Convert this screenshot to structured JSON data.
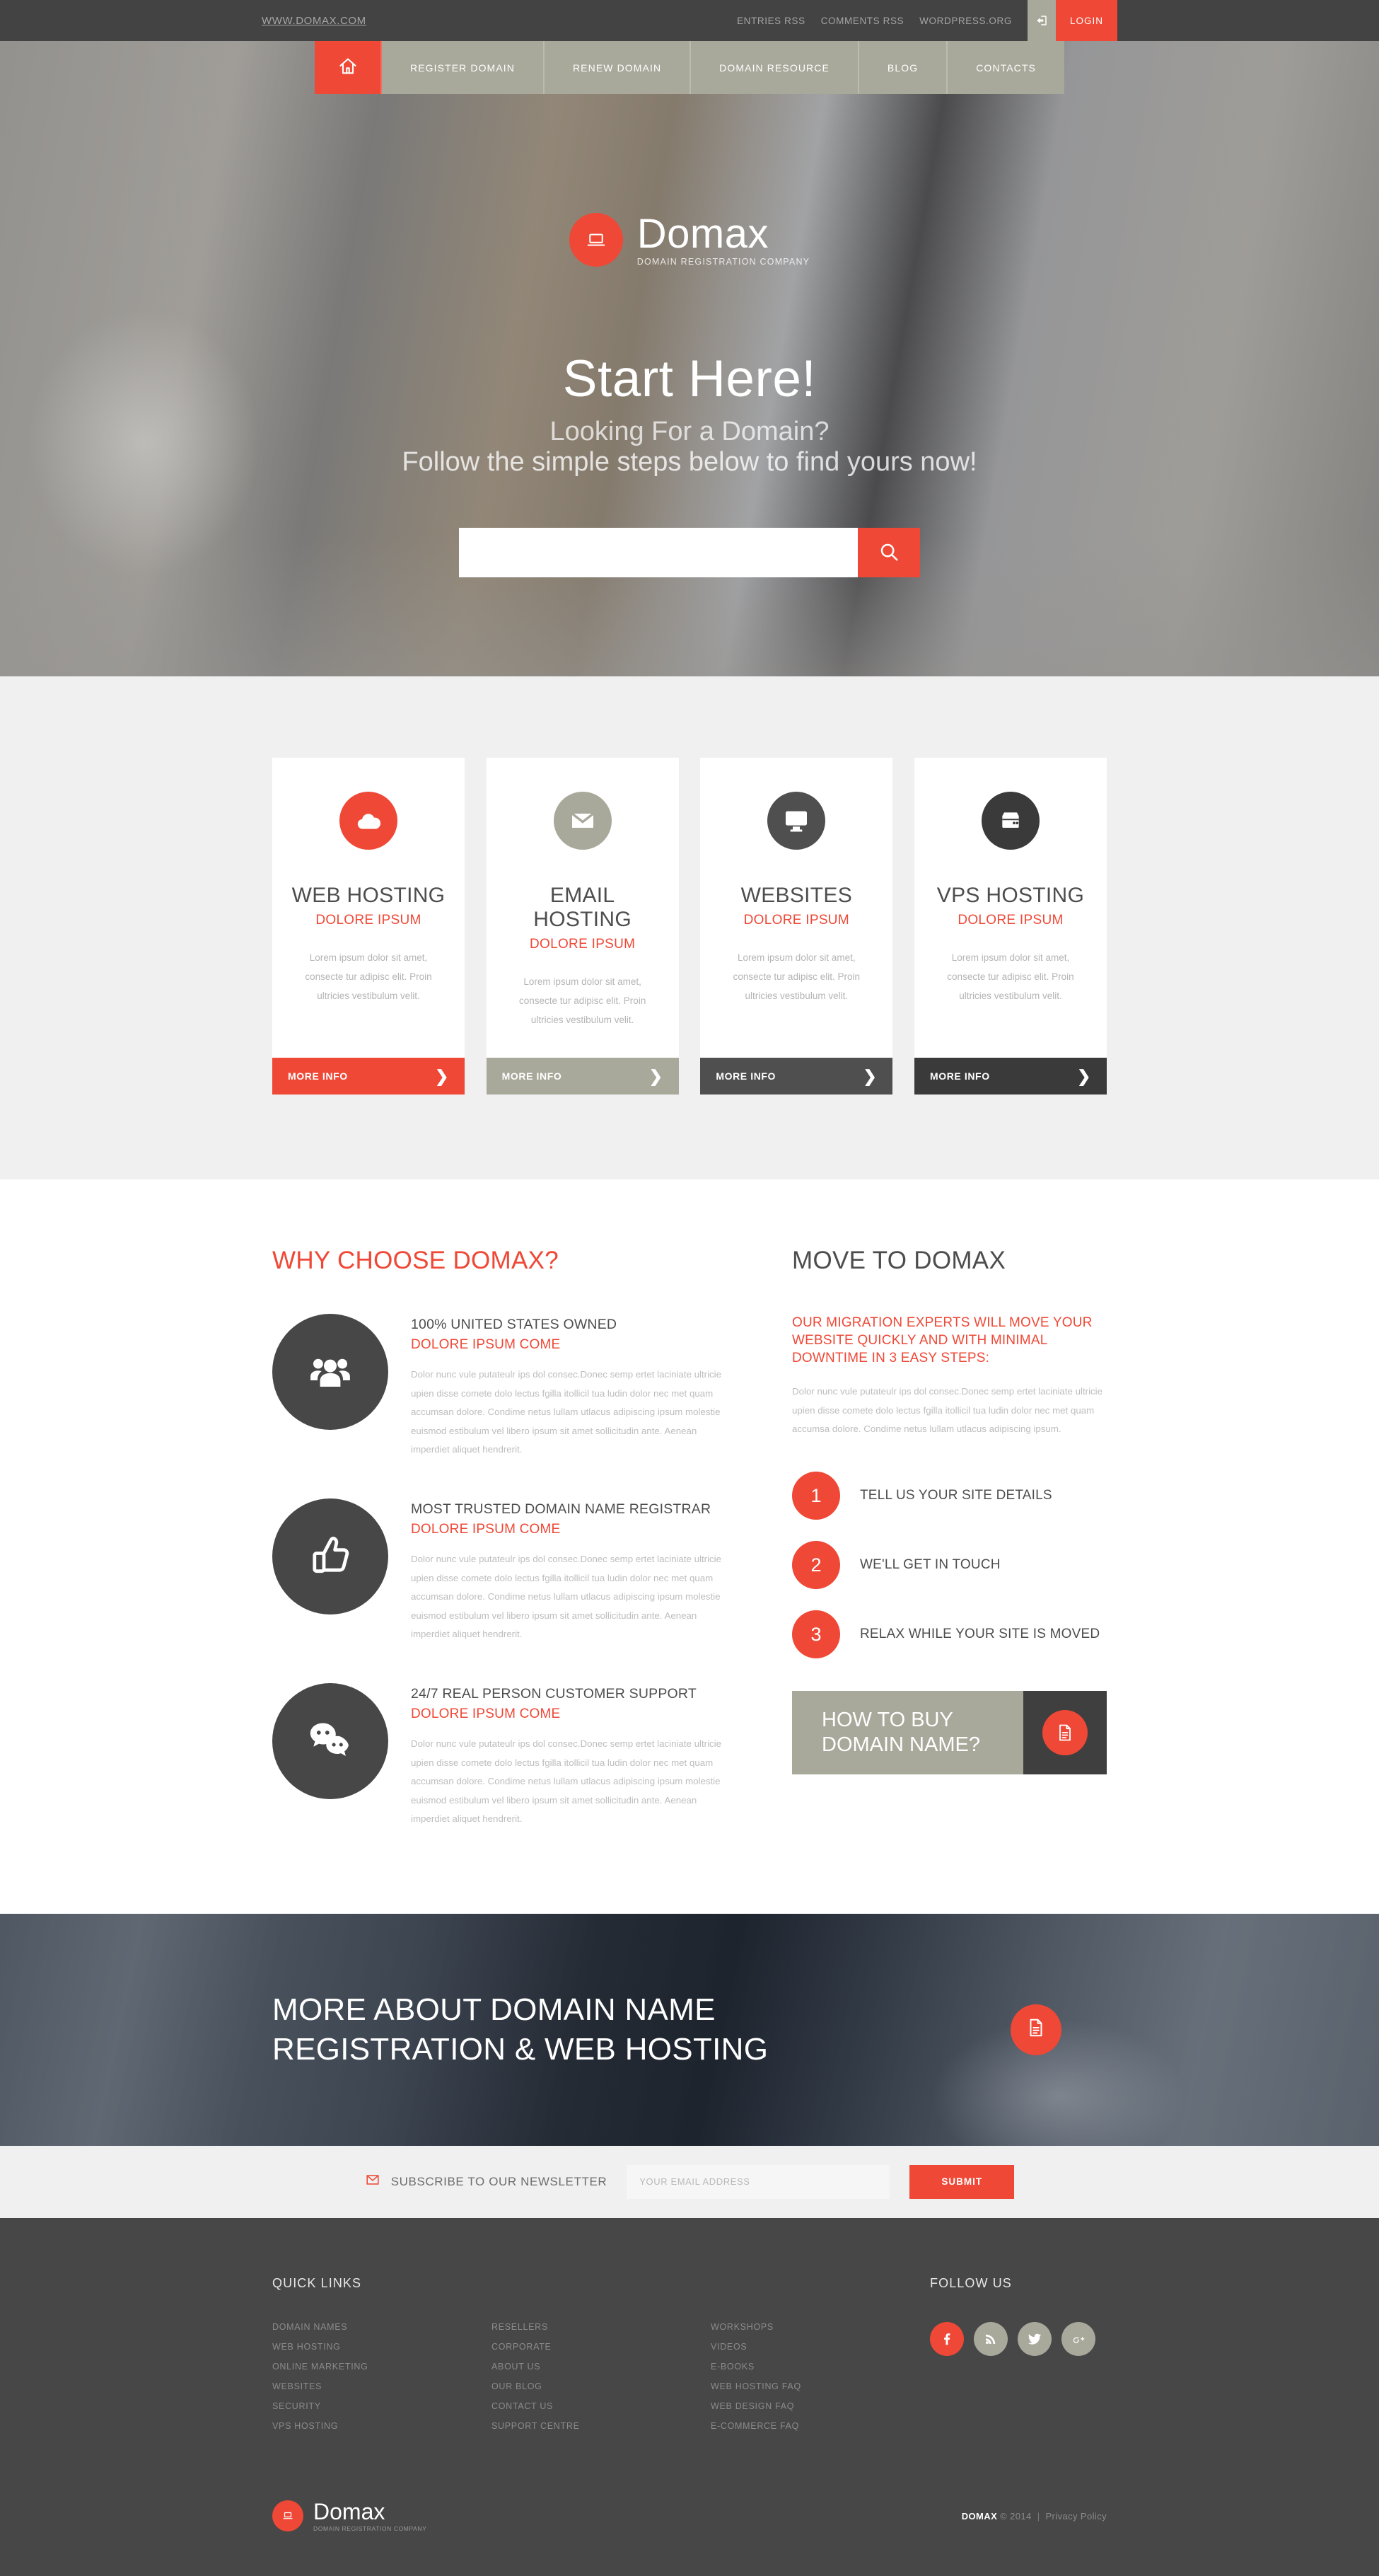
{
  "topbar": {
    "site_url": "WWW.DOMAX.COM",
    "links": [
      "ENTRIES RSS",
      "COMMENTS RSS",
      "WORDPRESS.ORG"
    ],
    "login_label": "LOGIN",
    "login_icon": "login-arrow-icon"
  },
  "nav": {
    "home_icon": "home-icon",
    "items": [
      "REGISTER DOMAIN",
      "RENEW DOMAIN",
      "DOMAIN RESOURCE",
      "BLOG",
      "CONTACTS"
    ]
  },
  "hero": {
    "logo_icon": "laptop-icon",
    "logo_name": "Domax",
    "logo_tagline": "DOMAIN REGISTRATION COMPANY",
    "heading": "Start Here!",
    "sub1": "Looking For a Domain?",
    "sub2": "Follow the simple steps below to find yours now!",
    "search_value": "",
    "search_placeholder": "",
    "search_icon": "search-icon"
  },
  "services": [
    {
      "icon": "cloud-icon",
      "icon_bg": "#ef4836",
      "title": "WEB HOSTING",
      "subtitle": "DOLORE IPSUM",
      "text": "Lorem ipsum dolor sit amet, consecte tur adipisc elit. Proin ultricies vestibulum velit.",
      "button": "MORE INFO",
      "button_bg": "#ef4836"
    },
    {
      "icon": "envelope-icon",
      "icon_bg": "#a8a89b",
      "title": "EMAIL HOSTING",
      "subtitle": "DOLORE IPSUM",
      "text": "Lorem ipsum dolor sit amet, consecte tur adipisc elit. Proin ultricies vestibulum velit.",
      "button": "MORE INFO",
      "button_bg": "#a8a89b"
    },
    {
      "icon": "monitor-icon",
      "icon_bg": "#4f4f4f",
      "title": "WEBSITES",
      "subtitle": "DOLORE IPSUM",
      "text": "Lorem ipsum dolor sit amet, consecte tur adipisc elit. Proin ultricies vestibulum velit.",
      "button": "MORE INFO",
      "button_bg": "#4f4f4f"
    },
    {
      "icon": "server-icon",
      "icon_bg": "#3a3a3a",
      "title": "VPS HOSTING",
      "subtitle": "DOLORE IPSUM",
      "text": "Lorem ipsum dolor sit amet, consecte tur adipisc elit. Proin ultricies vestibulum velit.",
      "button": "MORE INFO",
      "button_bg": "#3a3a3a"
    }
  ],
  "why": {
    "title": "WHY CHOOSE DOMAX?",
    "features": [
      {
        "icon": "users-group-icon",
        "title": "100% UNITED STATES OWNED",
        "subtitle": "DOLORE IPSUM COME",
        "text": "Dolor nunc vule putateulr ips dol consec.Donec semp ertet laciniate ultricie upien disse comete dolo lectus fgilla itollicil tua ludin dolor nec met quam accumsan dolore. Condime netus lullam utlacus adipiscing ipsum molestie euismod estibulum vel libero ipsum sit amet sollicitudin ante. Aenean imperdiet aliquet hendrerit."
      },
      {
        "icon": "thumbs-up-icon",
        "title": "MOST TRUSTED DOMAIN NAME REGISTRAR",
        "subtitle": "DOLORE IPSUM COME",
        "text": "Dolor nunc vule putateulr ips dol consec.Donec semp ertet laciniate ultricie upien disse comete dolo lectus fgilla itollicil tua ludin dolor nec met quam accumsan dolore. Condime netus lullam utlacus adipiscing ipsum molestie euismod estibulum vel libero ipsum sit amet sollicitudin ante. Aenean imperdiet aliquet hendrerit."
      },
      {
        "icon": "chat-bubbles-icon",
        "title": "24/7 REAL PERSON CUSTOMER SUPPORT",
        "subtitle": "DOLORE IPSUM COME",
        "text": "Dolor nunc vule putateulr ips dol consec.Donec semp ertet laciniate ultricie upien disse comete dolo lectus fgilla itollicil tua ludin dolor nec met quam accumsan dolore. Condime netus lullam utlacus adipiscing ipsum molestie euismod estibulum vel libero ipsum sit amet sollicitudin ante. Aenean imperdiet aliquet hendrerit."
      }
    ]
  },
  "move": {
    "title": "MOVE TO DOMAX",
    "lead": "OUR MIGRATION EXPERTS WILL MOVE YOUR WEBSITE QUICKLY AND WITH MINIMAL DOWNTIME IN 3 EASY STEPS:",
    "text": "Dolor nunc vule putateulr ips dol consec.Donec semp ertet laciniate ultricie upien disse comete dolo lectus fgilla itollicil tua ludin dolor nec met quam accumsa dolore. Condime netus lullam utlacus adipiscing ipsum.",
    "steps": [
      {
        "num": "1",
        "label": "TELL US YOUR SITE DETAILS"
      },
      {
        "num": "2",
        "label": "WE'LL GET IN TOUCH"
      },
      {
        "num": "3",
        "label": "RELAX WHILE YOUR SITE IS MOVED"
      }
    ],
    "howto_line1": "HOW TO BUY",
    "howto_line2": "DOMAIN NAME?",
    "howto_icon": "document-icon"
  },
  "banner": {
    "line1": "MORE ABOUT DOMAIN NAME",
    "line2": "REGISTRATION & WEB HOSTING",
    "icon": "document-icon"
  },
  "newsletter": {
    "icon": "envelope-outline-icon",
    "label": "SUBSCRIBE TO OUR NEWSLETTER",
    "input_value": "",
    "input_placeholder": "YOUR EMAIL ADDRESS",
    "submit_label": "SUBMIT"
  },
  "footer": {
    "quick_links_heading": "QUICK LINKS",
    "quick_links": [
      [
        "DOMAIN NAMES",
        "WEB HOSTING",
        "ONLINE MARKETING",
        "WEBSITES",
        "SECURITY",
        "VPS HOSTING"
      ],
      [
        "RESELLERS",
        "CORPORATE",
        "ABOUT US",
        "OUR BLOG",
        "CONTACT US",
        "SUPPORT CENTRE"
      ],
      [
        "WORKSHOPS",
        "VIDEOS",
        "E-BOOKS",
        "WEB HOSTING FAQ",
        "WEB DESIGN FAQ",
        "E-COMMERCE FAQ"
      ]
    ],
    "follow_heading": "FOLLOW US",
    "social": [
      {
        "name": "facebook-icon",
        "bg": "#ef4836"
      },
      {
        "name": "rss-icon",
        "bg": "#a8a89b"
      },
      {
        "name": "twitter-icon",
        "bg": "#a8a89b"
      },
      {
        "name": "google-plus-icon",
        "bg": "#a8a89b"
      }
    ],
    "logo_icon": "laptop-icon",
    "logo_name": "Domax",
    "logo_tagline": "DOMAIN REGISTRATION COMPANY",
    "copyright_brand": "DOMAX",
    "copyright_text": "© 2014",
    "copyright_sep": "|",
    "copyright_link": "Privacy Policy"
  },
  "colors": {
    "accent": "#ef4836",
    "khaki": "#a8a89b",
    "dark": "#474747",
    "darker": "#3a3a3a",
    "light_bg": "#f0f0f0"
  }
}
